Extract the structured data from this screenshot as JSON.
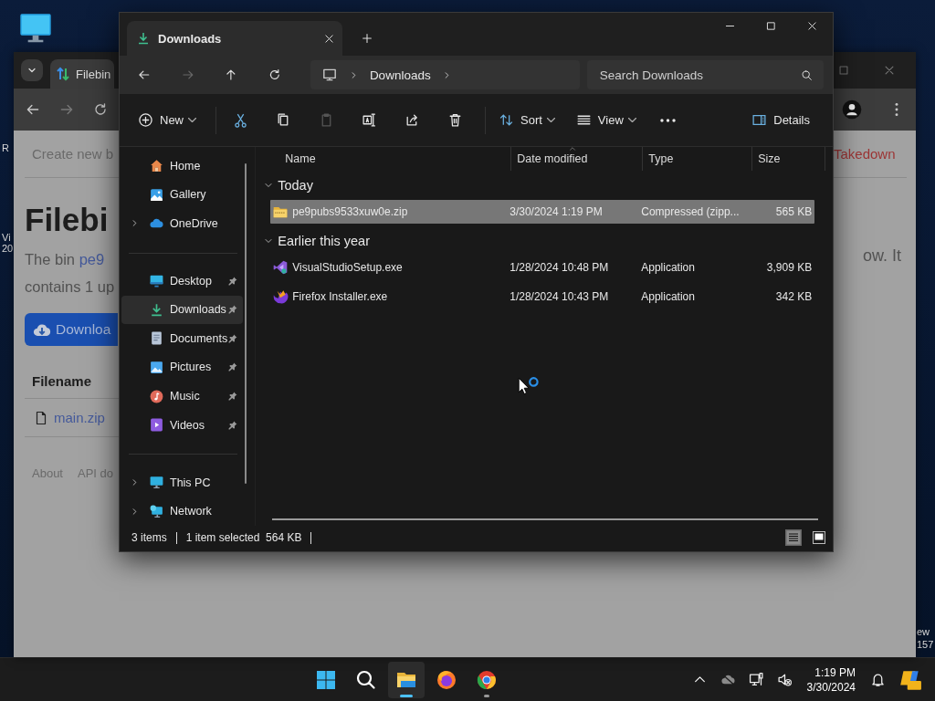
{
  "desktop": {
    "left_edge_labels": [
      "R",
      "Vi",
      "20"
    ],
    "right_edge_labels": [
      "ew",
      "157"
    ]
  },
  "browser": {
    "tab_title": "Filebin",
    "page": {
      "top_link": "Create new b",
      "heading": "Filebi",
      "intro_text": "The bin",
      "intro_link": "pe9",
      "intro_line2": "contains 1 up",
      "download_button": "Downloa",
      "table_header": "Filename",
      "file_link": "main.zip",
      "footer_links": [
        "About",
        "API do"
      ],
      "right_link": "Takedown",
      "right_text": "ow. It"
    }
  },
  "explorer": {
    "tabs": [
      {
        "label": "Downloads",
        "selected": true
      }
    ],
    "breadcrumb": [
      "Downloads"
    ],
    "search": {
      "placeholder": "Search Downloads"
    },
    "commands": [
      {
        "kind": "new",
        "label": "New",
        "dropdown": true,
        "disabled": false
      },
      {
        "kind": "cut",
        "disabled": false
      },
      {
        "kind": "copy",
        "disabled": false
      },
      {
        "kind": "paste",
        "disabled": true
      },
      {
        "kind": "rename",
        "disabled": false
      },
      {
        "kind": "share",
        "disabled": false
      },
      {
        "kind": "delete",
        "disabled": false
      },
      {
        "kind": "sort",
        "label": "Sort",
        "dropdown": true,
        "disabled": false
      },
      {
        "kind": "view",
        "label": "View",
        "dropdown": true,
        "disabled": false
      },
      {
        "kind": "more",
        "disabled": false
      },
      {
        "kind": "details",
        "label": "Details",
        "disabled": false
      }
    ],
    "sidebar": {
      "sections": [
        {
          "items": [
            {
              "label": "Home",
              "kind": "home",
              "selected": false,
              "pinned": false
            },
            {
              "label": "Gallery",
              "kind": "gallery",
              "selected": false,
              "pinned": false
            },
            {
              "label": "OneDrive",
              "kind": "cloud",
              "selected": false,
              "pinned": false,
              "expanded": false
            }
          ]
        },
        {
          "items": [
            {
              "label": "Desktop",
              "kind": "desktop",
              "selected": false,
              "pinned": true
            },
            {
              "label": "Downloads",
              "kind": "download",
              "selected": true,
              "pinned": true
            },
            {
              "label": "Documents",
              "kind": "documents",
              "selected": false,
              "pinned": true
            },
            {
              "label": "Pictures",
              "kind": "pictures",
              "selected": false,
              "pinned": true
            },
            {
              "label": "Music",
              "kind": "music",
              "selected": false,
              "pinned": true
            },
            {
              "label": "Videos",
              "kind": "videos",
              "selected": false,
              "pinned": true
            }
          ]
        },
        {
          "items": [
            {
              "label": "This PC",
              "kind": "pc",
              "selected": false,
              "pinned": false,
              "expanded": false
            },
            {
              "label": "Network",
              "kind": "network",
              "selected": false,
              "pinned": false,
              "expanded": false
            }
          ]
        }
      ]
    },
    "columns": [
      {
        "label": "Name",
        "sorted": false
      },
      {
        "label": "Date modified",
        "sorted": true
      },
      {
        "label": "Type",
        "sorted": false
      },
      {
        "label": "Size",
        "sorted": false
      }
    ],
    "groups": [
      {
        "label": "Today",
        "expanded": true,
        "rows": [
          {
            "kind": "zip",
            "name": "pe9pubs9533xuw0e.zip",
            "date": "3/30/2024 1:19 PM",
            "type": "Compressed (zipp...",
            "size": "565 KB",
            "selected": true
          }
        ]
      },
      {
        "label": "Earlier this year",
        "expanded": true,
        "rows": [
          {
            "kind": "vs",
            "name": "VisualStudioSetup.exe",
            "date": "1/28/2024 10:48 PM",
            "type": "Application",
            "size": "3,909 KB",
            "selected": false
          },
          {
            "kind": "firefox",
            "name": "Firefox Installer.exe",
            "date": "1/28/2024 10:43 PM",
            "type": "Application",
            "size": "342 KB",
            "selected": false
          }
        ]
      }
    ],
    "status": {
      "count": "3 items",
      "selection": "1 item selected  564 KB"
    },
    "view_modes": [
      {
        "kind": "details",
        "selected": true
      },
      {
        "kind": "tiles",
        "selected": false
      }
    ]
  },
  "taskbar": {
    "apps": [
      {
        "kind": "start",
        "running": false,
        "active": false
      },
      {
        "kind": "search",
        "running": false,
        "active": false
      },
      {
        "kind": "explorer",
        "running": true,
        "active": true
      },
      {
        "kind": "firefox",
        "running": false,
        "active": false
      },
      {
        "kind": "chrome",
        "running": true,
        "active": false
      }
    ],
    "tray": [
      {
        "kind": "chevron"
      },
      {
        "kind": "cloud-off"
      },
      {
        "kind": "network"
      },
      {
        "kind": "volume-muted"
      }
    ],
    "clock": {
      "time": "1:19 PM",
      "date": "3/30/2024"
    }
  }
}
